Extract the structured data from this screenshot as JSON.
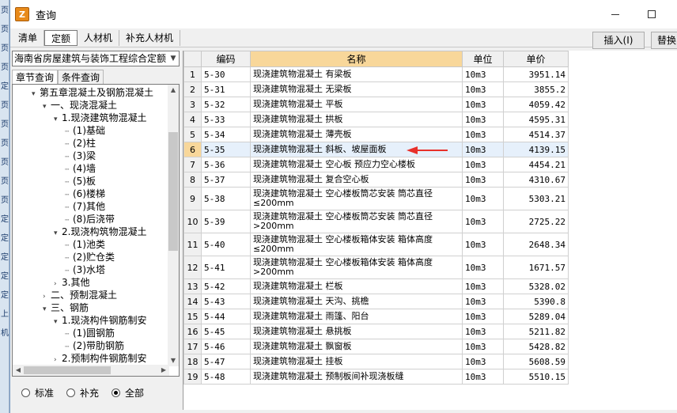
{
  "background_app": {
    "strip_chars": [
      "页",
      "页",
      "页",
      "页",
      "定",
      "页",
      "页",
      "页",
      "页",
      "页",
      "页",
      "定",
      "定",
      "定",
      "定",
      "定",
      "上",
      "机"
    ]
  },
  "window": {
    "title": "查询",
    "icon_letter": "Z"
  },
  "tabs": [
    "清单",
    "定额",
    "人材机",
    "补充人材机"
  ],
  "active_tab": "定额",
  "toolbar": {
    "insert_label": "插入(I)",
    "replace_label": "替换"
  },
  "left": {
    "library_select": "海南省房屋建筑与装饰工程综合定额",
    "subtabs": [
      "章节查询",
      "条件查询"
    ],
    "tree": [
      {
        "label": "第五章混凝土及钢筋混凝土",
        "exp": "▾",
        "indent": 0
      },
      {
        "label": "一、现浇混凝土",
        "exp": "▾",
        "indent": 1
      },
      {
        "label": "1.现浇建筑物混凝土",
        "exp": "▾",
        "indent": 2
      },
      {
        "label": "(1)基础",
        "exp": "",
        "indent": 3
      },
      {
        "label": "(2)柱",
        "exp": "",
        "indent": 3
      },
      {
        "label": "(3)梁",
        "exp": "",
        "indent": 3
      },
      {
        "label": "(4)墙",
        "exp": "",
        "indent": 3
      },
      {
        "label": "(5)板",
        "exp": "",
        "indent": 3
      },
      {
        "label": "(6)楼梯",
        "exp": "",
        "indent": 3
      },
      {
        "label": "(7)其他",
        "exp": "",
        "indent": 3
      },
      {
        "label": "(8)后浇带",
        "exp": "",
        "indent": 3
      },
      {
        "label": "2.现浇构筑物混凝土",
        "exp": "▾",
        "indent": 2
      },
      {
        "label": "(1)池类",
        "exp": "",
        "indent": 3
      },
      {
        "label": "(2)贮仓类",
        "exp": "",
        "indent": 3
      },
      {
        "label": "(3)水塔",
        "exp": "",
        "indent": 3
      },
      {
        "label": "3.其他",
        "exp": "›",
        "indent": 2
      },
      {
        "label": "二、预制混凝土",
        "exp": "›",
        "indent": 1
      },
      {
        "label": "三、钢筋",
        "exp": "▾",
        "indent": 1
      },
      {
        "label": "1.现浇构件钢筋制安",
        "exp": "▾",
        "indent": 2
      },
      {
        "label": "(1)圆钢筋",
        "exp": "",
        "indent": 3
      },
      {
        "label": "(2)带肋钢筋",
        "exp": "",
        "indent": 3
      },
      {
        "label": "2.预制构件钢筋制安",
        "exp": "›",
        "indent": 2
      }
    ],
    "radios": [
      {
        "label": "标准",
        "checked": false
      },
      {
        "label": "补充",
        "checked": false
      },
      {
        "label": "全部",
        "checked": true
      }
    ]
  },
  "grid": {
    "headers": [
      "",
      "编码",
      "名称",
      "单位",
      "单价"
    ],
    "selected_row": 6,
    "rows": [
      {
        "n": "1",
        "code": "5-30",
        "name": "现浇建筑物混凝土 有梁板",
        "unit": "10m3",
        "price": "3951.14"
      },
      {
        "n": "2",
        "code": "5-31",
        "name": "现浇建筑物混凝土 无梁板",
        "unit": "10m3",
        "price": "3855.2"
      },
      {
        "n": "3",
        "code": "5-32",
        "name": "现浇建筑物混凝土 平板",
        "unit": "10m3",
        "price": "4059.42"
      },
      {
        "n": "4",
        "code": "5-33",
        "name": "现浇建筑物混凝土 拱板",
        "unit": "10m3",
        "price": "4595.31"
      },
      {
        "n": "5",
        "code": "5-34",
        "name": "现浇建筑物混凝土 薄壳板",
        "unit": "10m3",
        "price": "4514.37"
      },
      {
        "n": "6",
        "code": "5-35",
        "name": "现浇建筑物混凝土 斜板、坡屋面板",
        "unit": "10m3",
        "price": "4139.15"
      },
      {
        "n": "7",
        "code": "5-36",
        "name": "现浇建筑物混凝土 空心板 预应力空心楼板",
        "unit": "10m3",
        "price": "4454.21"
      },
      {
        "n": "8",
        "code": "5-37",
        "name": "现浇建筑物混凝土 复合空心板",
        "unit": "10m3",
        "price": "4310.67"
      },
      {
        "n": "9",
        "code": "5-38",
        "name": "现浇建筑物混凝土 空心楼板筒芯安装 筒芯直径≤200mm",
        "unit": "10m3",
        "price": "5303.21"
      },
      {
        "n": "10",
        "code": "5-39",
        "name": "现浇建筑物混凝土 空心楼板筒芯安装 筒芯直径>200mm",
        "unit": "10m3",
        "price": "2725.22"
      },
      {
        "n": "11",
        "code": "5-40",
        "name": "现浇建筑物混凝土 空心楼板箱体安装 箱体高度≤200mm",
        "unit": "10m3",
        "price": "2648.34"
      },
      {
        "n": "12",
        "code": "5-41",
        "name": "现浇建筑物混凝土 空心楼板箱体安装 箱体高度>200mm",
        "unit": "10m3",
        "price": "1671.57"
      },
      {
        "n": "13",
        "code": "5-42",
        "name": "现浇建筑物混凝土 栏板",
        "unit": "10m3",
        "price": "5328.02"
      },
      {
        "n": "14",
        "code": "5-43",
        "name": "现浇建筑物混凝土 天沟、挑檐",
        "unit": "10m3",
        "price": "5390.8"
      },
      {
        "n": "15",
        "code": "5-44",
        "name": "现浇建筑物混凝土 雨篷、阳台",
        "unit": "10m3",
        "price": "5289.04"
      },
      {
        "n": "16",
        "code": "5-45",
        "name": "现浇建筑物混凝土 悬挑板",
        "unit": "10m3",
        "price": "5211.82"
      },
      {
        "n": "17",
        "code": "5-46",
        "name": "现浇建筑物混凝土 飘窗板",
        "unit": "10m3",
        "price": "5428.82"
      },
      {
        "n": "18",
        "code": "5-47",
        "name": "现浇建筑物混凝土 挂板",
        "unit": "10m3",
        "price": "5608.59"
      },
      {
        "n": "19",
        "code": "5-48",
        "name": "现浇建筑物混凝土 预制板间补现浇板缝",
        "unit": "10m3",
        "price": "5510.15"
      }
    ]
  },
  "colors": {
    "header_highlight": "#f8d79a",
    "selected_row": "#e6f0fb",
    "arrow": "#e8302a"
  }
}
